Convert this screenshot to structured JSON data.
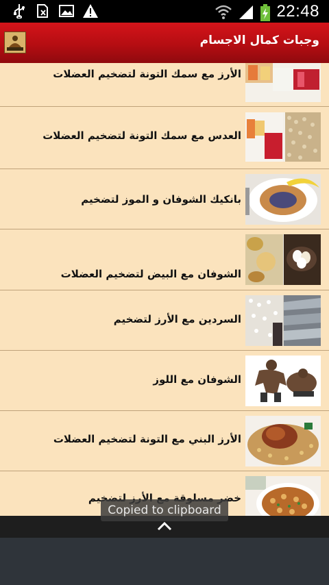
{
  "status_bar": {
    "time": "22:48",
    "icons": [
      "usb-icon",
      "sim-icon",
      "image-icon",
      "warning-icon",
      "wifi-icon",
      "signal-icon",
      "battery-charging-icon"
    ]
  },
  "app_bar": {
    "title": "وجبات كمال الاجسام",
    "logo_icon": "app-logo-icon"
  },
  "list": {
    "items": [
      {
        "label": "الأرز مع سمك التونة  لتضخيم  العضلات"
      },
      {
        "label": "العدس مع سمك التونة  لتضخيم  العضلات"
      },
      {
        "label": "بانكيك الشوفان و الموز  لتضخيم"
      },
      {
        "label": "الشوفان مع البيض  لتضخيم  العضلات"
      },
      {
        "label": "السردين مع الأرز  لتضخيم"
      },
      {
        "label": "الشوفان مع اللوز"
      },
      {
        "label": "الأرز البني مع التونة  لتضخيم  العضلات"
      },
      {
        "label": "خضر مسلوقة مع الأرز  لتضخيم"
      }
    ]
  },
  "toast": {
    "text": "Copied to clipboard"
  },
  "bottom_bar": {
    "icon": "chevron-up-icon"
  },
  "colors": {
    "app_bar": "#c4121a",
    "list_bg": "#fbe3bd",
    "divider": "#bfa27a"
  }
}
